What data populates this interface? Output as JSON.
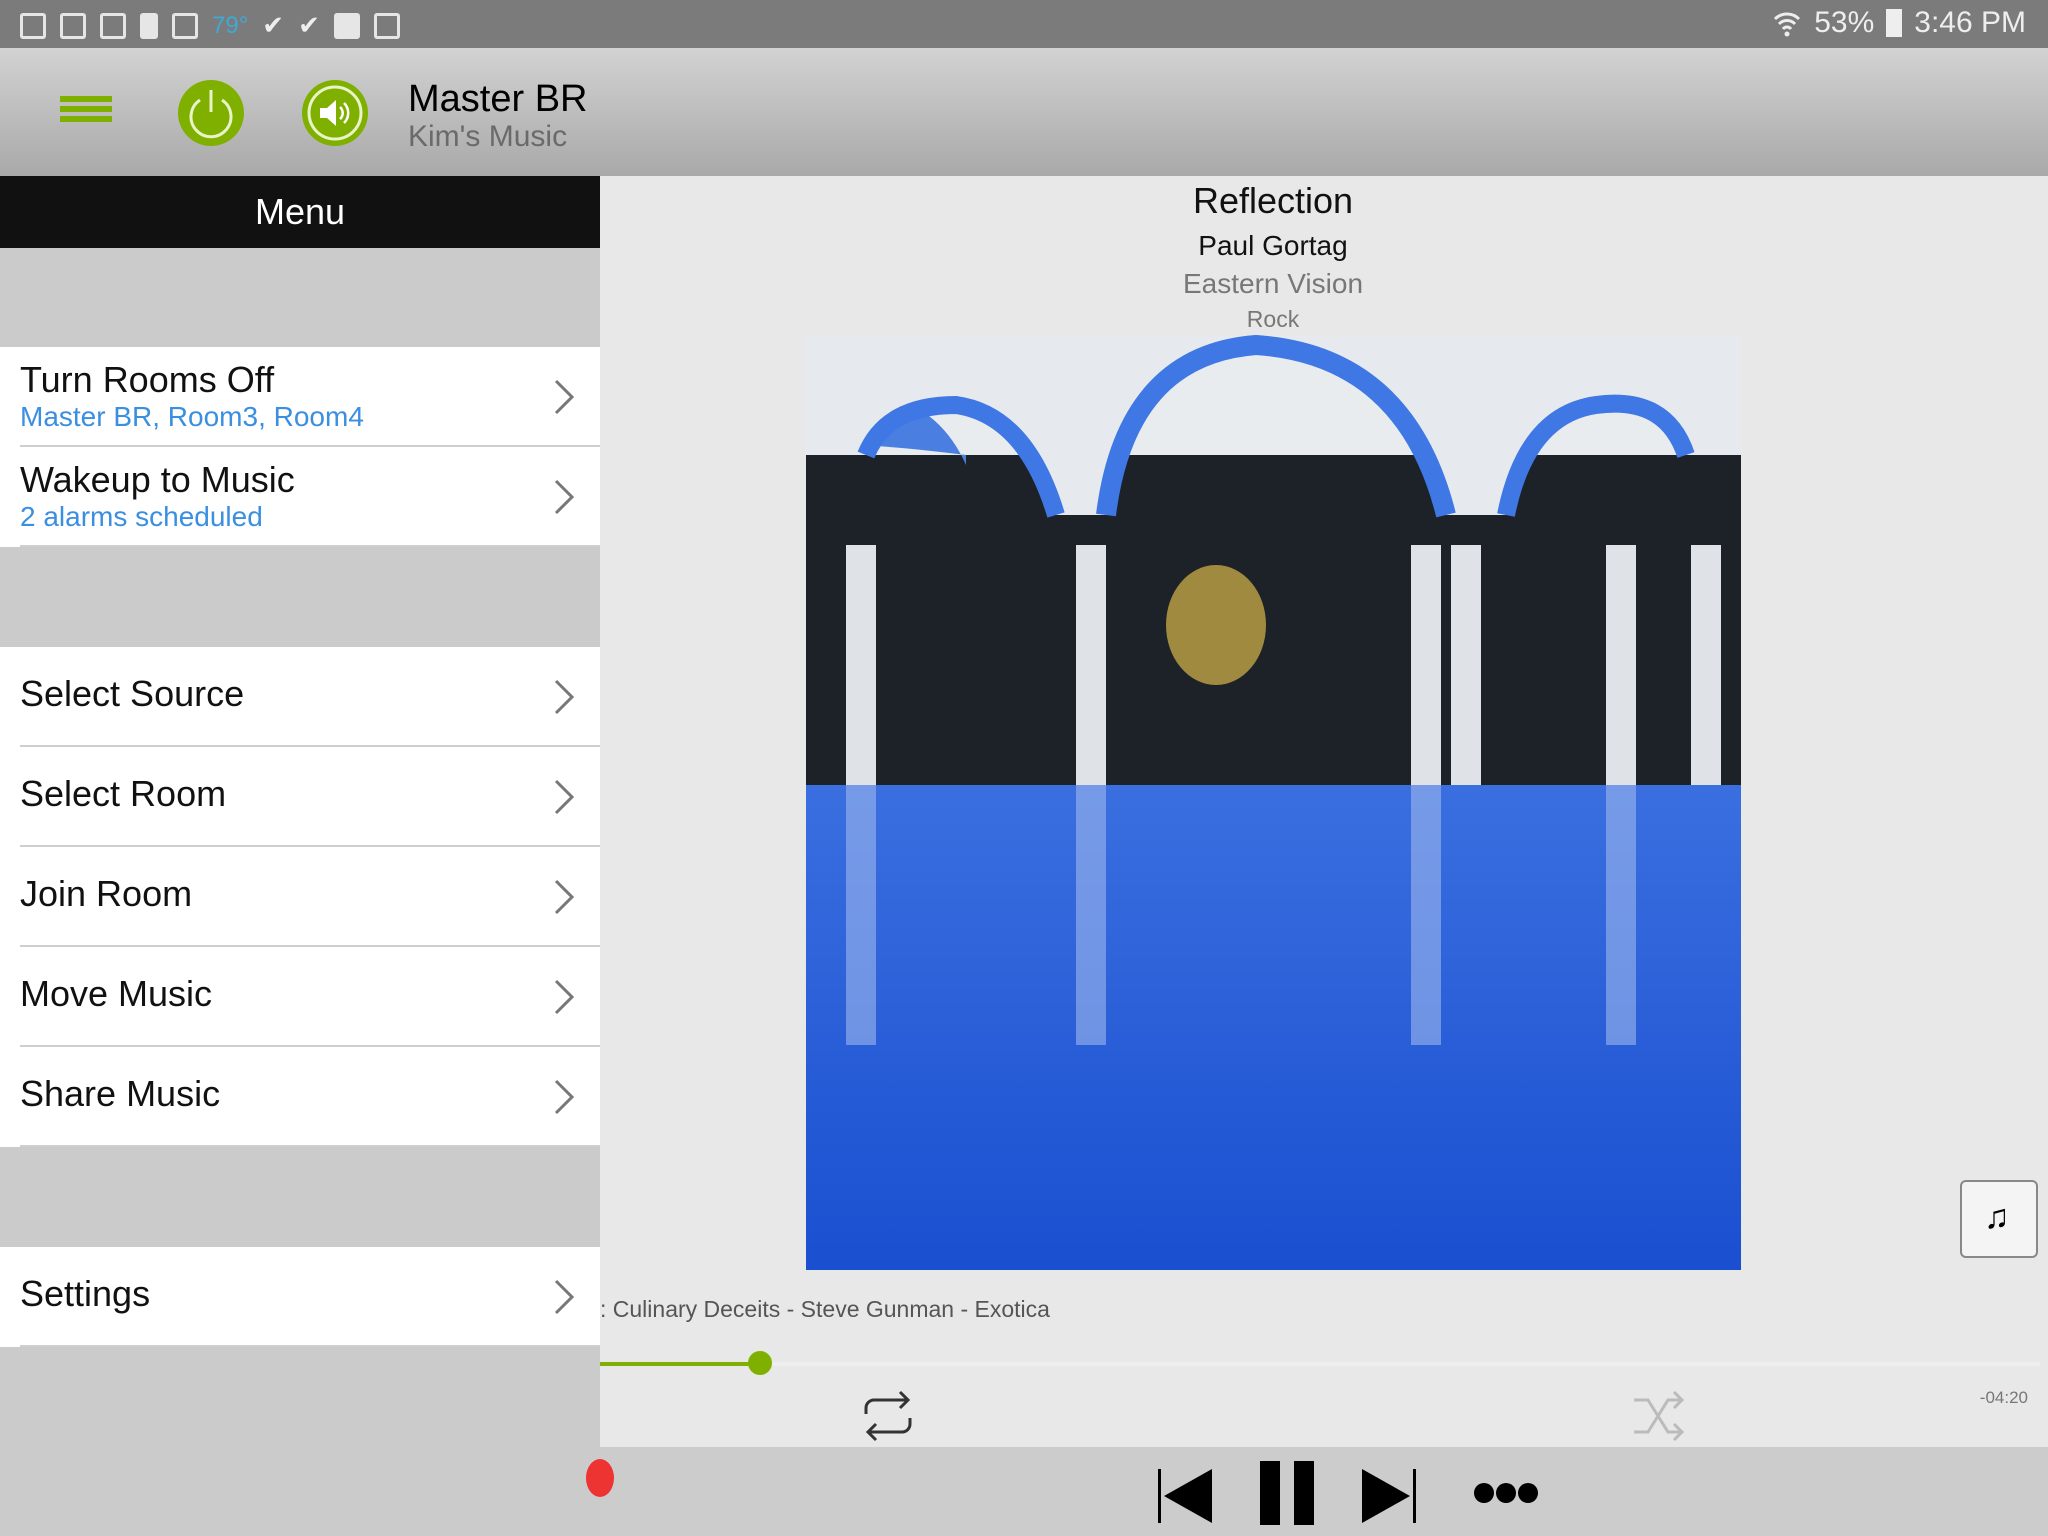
{
  "status_bar": {
    "icons": [
      "tablet-check-icon",
      "image-icon",
      "mail-icon",
      "battery-recycle-icon",
      "mail-icon"
    ],
    "temperature": "79°",
    "wifi": "wifi-icon",
    "battery": "53%",
    "time": "3:46 PM"
  },
  "header": {
    "room": "Master BR",
    "source": "Kim's Music",
    "accent": "#7fb000"
  },
  "menu": {
    "title": "Menu",
    "items": [
      {
        "label": "Turn Rooms Off",
        "sub": "Master BR, Room3, Room4"
      },
      {
        "label": "Wakeup to Music",
        "sub": "2 alarms scheduled"
      },
      {
        "label": "Select Source"
      },
      {
        "label": "Select Room"
      },
      {
        "label": "Join Room"
      },
      {
        "label": "Move Music"
      },
      {
        "label": "Share Music"
      },
      {
        "label": "Settings"
      }
    ]
  },
  "now_playing": {
    "title": "Reflection",
    "artist": "Paul Gortag",
    "album": "Eastern Vision",
    "genre": "Rock",
    "next_track": ": Culinary Deceits - Steve Gunman - Exotica",
    "remaining": "-04:20",
    "progress_percent": 10
  }
}
